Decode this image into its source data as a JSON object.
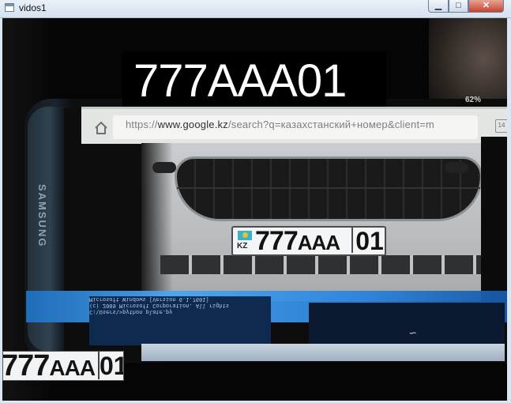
{
  "window": {
    "title": "vidos1",
    "buttons": {
      "minimize": "▁",
      "maximize": "□",
      "close": "✕"
    }
  },
  "overlay": {
    "recognized_plate": "777AAA01"
  },
  "browser": {
    "url_prefix": "https://",
    "url_domain": "www.google.kz",
    "url_rest": "/search?q=казахстанский+номер&client=m",
    "tabs_count": "14",
    "status": "62%"
  },
  "phone": {
    "brand": "SAMSUNG"
  },
  "plate": {
    "country": "KZ",
    "digits": "777",
    "letters": "AAA",
    "region": "01"
  },
  "crop": {
    "digits": "777",
    "letters": "AAA",
    "region": "01"
  }
}
